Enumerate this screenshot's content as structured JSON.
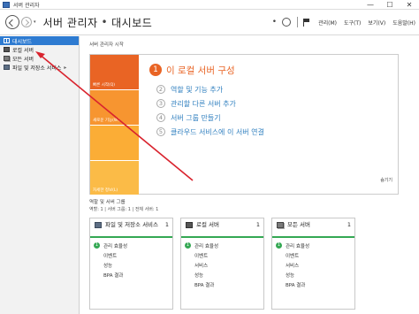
{
  "window": {
    "title": "서버 관리자",
    "controls": [
      "—",
      "☐",
      "✕"
    ]
  },
  "header": {
    "breadcrumb_app": "서버 관리자",
    "breadcrumb_sep": "•",
    "breadcrumb_page": "대시보드",
    "menu": [
      "관리(M)",
      "도구(T)",
      "보기(V)",
      "도움말(H)"
    ]
  },
  "sidebar": {
    "items": [
      {
        "label": "대시보드",
        "icon": "dashboard-icon",
        "active": true
      },
      {
        "label": "로컬 서버",
        "icon": "server-icon",
        "active": false
      },
      {
        "label": "모든 서버",
        "icon": "servers-icon",
        "active": false
      },
      {
        "label": "파일 및 저장소 서비스",
        "icon": "folder-icon",
        "active": false,
        "expand": "▸"
      }
    ]
  },
  "welcome": {
    "section_label": "서버 관리자 시작",
    "tiles": [
      "빠른 시작(Q)",
      "새로운 기능(W)",
      "",
      "자세한 정보(L)"
    ],
    "main_step": {
      "num": "1",
      "text": "이 로컬 서버 구성"
    },
    "steps": [
      {
        "num": "2",
        "text": "역할 및 기능 추가"
      },
      {
        "num": "3",
        "text": "관리할 다른 서버 추가"
      },
      {
        "num": "4",
        "text": "서버 그룹 만들기"
      },
      {
        "num": "5",
        "text": "클라우드 서비스에 이 서버 연결"
      }
    ],
    "hide": "숨기기"
  },
  "roles": {
    "label": "역할 및 서버 그룹",
    "summary": "역할: 1  |  서버 그룹: 1  |  전체 서버: 1"
  },
  "cards": [
    {
      "title": "파일 및 저장소 서비스",
      "count": "1",
      "icon": "folder-icon",
      "rows": [
        {
          "badge": "1",
          "text": "관리 효율성"
        },
        {
          "text": "이벤트"
        },
        {
          "text": "성능"
        },
        {
          "text": "BPA 결과"
        }
      ]
    },
    {
      "title": "로컬 서버",
      "count": "1",
      "icon": "server-icon",
      "rows": [
        {
          "badge": "1",
          "text": "관리 효율성"
        },
        {
          "text": "이벤트"
        },
        {
          "text": "서비스"
        },
        {
          "text": "성능"
        },
        {
          "text": "BPA 결과"
        }
      ]
    },
    {
      "title": "모든 서버",
      "count": "1",
      "icon": "servers-icon",
      "rows": [
        {
          "badge": "1",
          "text": "관리 효율성"
        },
        {
          "text": "이벤트"
        },
        {
          "text": "서비스"
        },
        {
          "text": "성능"
        },
        {
          "text": "BPA 결과"
        }
      ]
    }
  ],
  "colors": {
    "accent_blue": "#2e7bd1",
    "orange": "#e96424",
    "green": "#34a853",
    "annotation_red": "#d9232e"
  }
}
